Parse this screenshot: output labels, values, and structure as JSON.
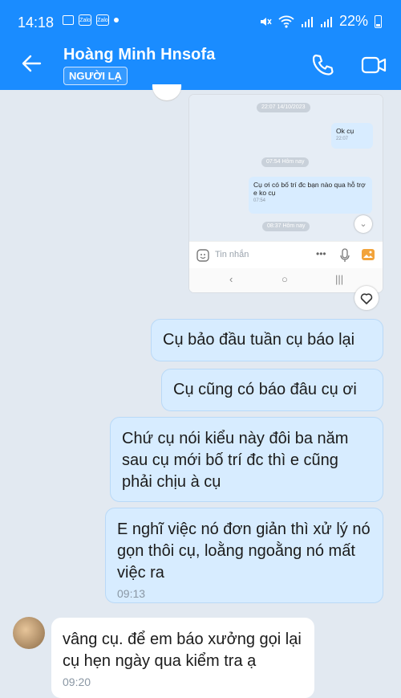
{
  "status_bar": {
    "time": "14:18",
    "battery": "22%",
    "app_icons": [
      "Zalo",
      "Zalo"
    ]
  },
  "header": {
    "contact_name": "Hoàng Minh Hnsofa",
    "badge": "NGƯỜI LẠ",
    "icons": [
      "back-arrow-icon",
      "phone-icon",
      "video-camera-icon"
    ]
  },
  "screenshot": {
    "stamps": [
      "22:07 14/10/2023",
      "07:54 Hôm nay",
      "08:37 Hôm nay"
    ],
    "messages": [
      {
        "text": "Ok cụ",
        "time": "22:07"
      },
      {
        "text": "Cụ ơi có bố trí đc bạn nào qua hỗ trợ e ko cụ",
        "time": "07:54"
      }
    ],
    "input_placeholder": "Tin nhắn"
  },
  "messages": [
    {
      "text": "Cụ bảo đầu tuần cụ báo lại",
      "side": "me"
    },
    {
      "text": "Cụ cũng có báo đâu cụ ơi",
      "side": "me"
    },
    {
      "text": "Chứ cụ nói kiểu này đôi ba năm sau cụ mới bố trí đc thì e cũng phải chịu à cụ",
      "side": "me"
    },
    {
      "text": "E nghĩ việc nó đơn giản thì xử lý nó gọn thôi cụ, loằng ngoằng nó mất việc ra",
      "time": "09:13",
      "side": "me"
    },
    {
      "text": "vâng cụ. để em báo xưởng gọi lại cụ hẹn ngày qua kiểm tra ạ",
      "time": "09:20",
      "side": "other"
    }
  ],
  "colors": {
    "header": "#1a8cff",
    "my_bubble": "#d7ecff",
    "background": "#e2e9f1"
  }
}
